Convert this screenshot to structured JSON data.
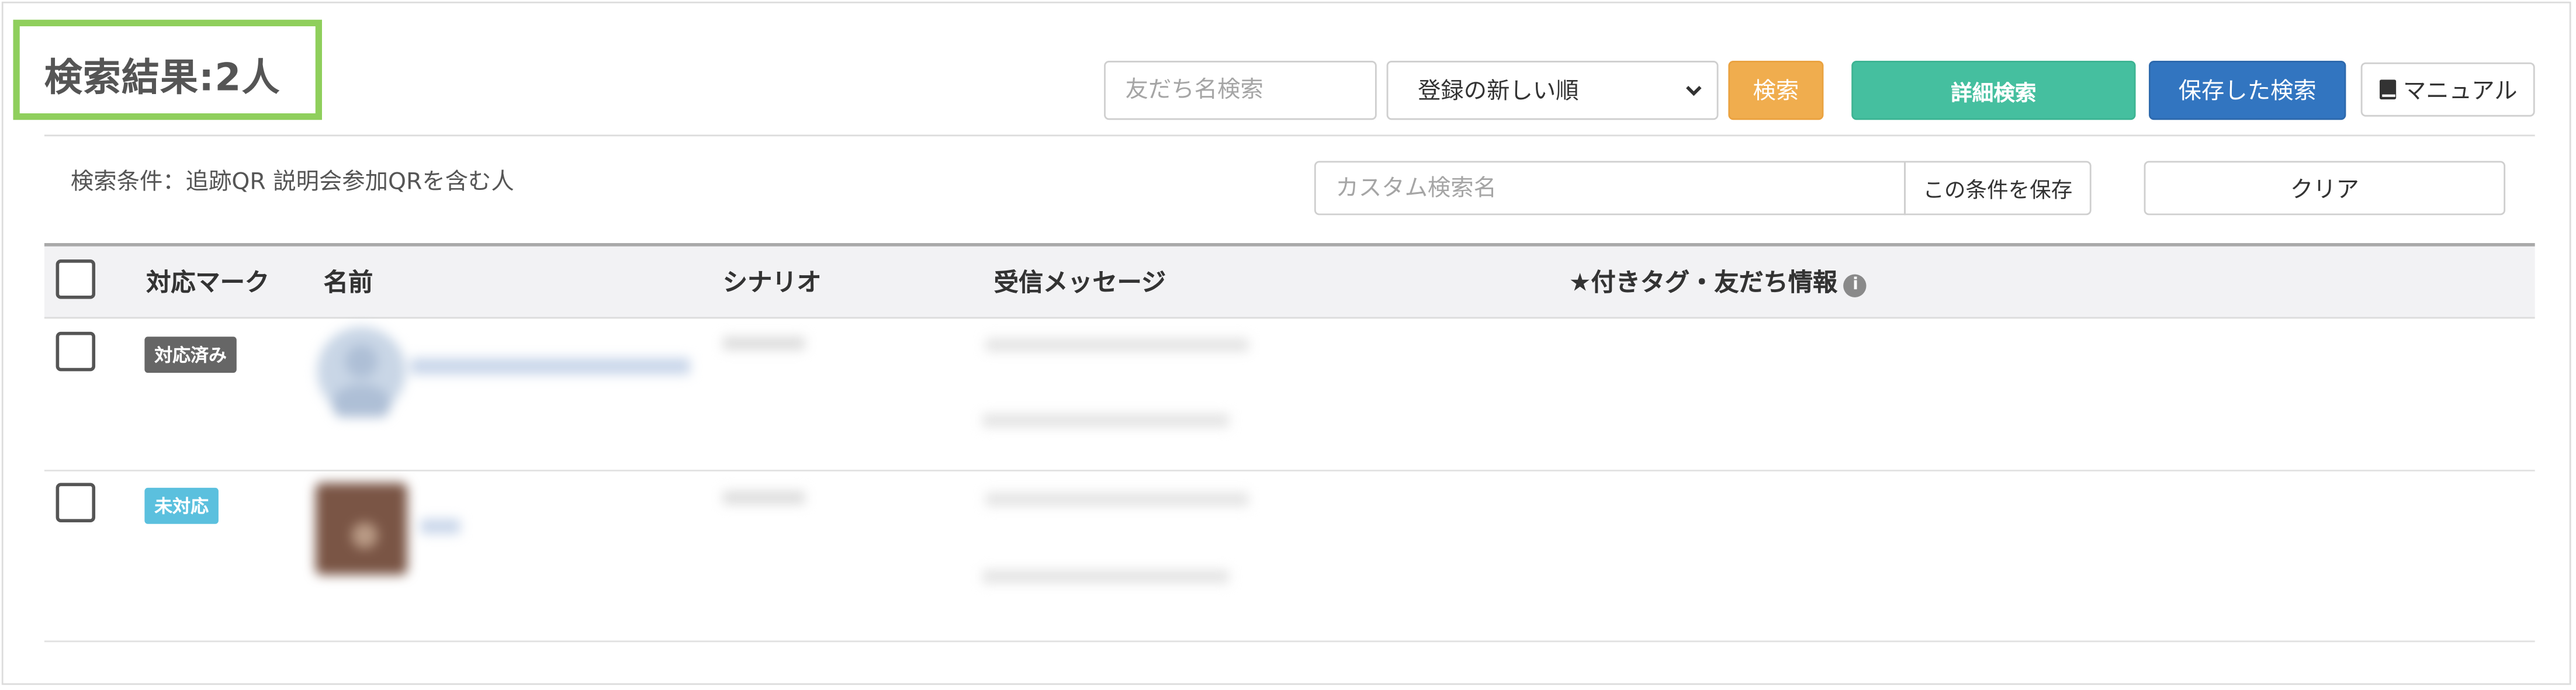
{
  "header": {
    "title": "検索結果:2人"
  },
  "toolbar": {
    "friend_search_placeholder": "友だち名検索",
    "sort_selected": "登録の新しい順",
    "search_label": "検索",
    "advanced_search_label": "詳細検索",
    "saved_search_label": "保存した検索",
    "manual_label": "マニュアル"
  },
  "conditions": {
    "text": "検索条件：追跡QR 説明会参加QRを含む人",
    "custom_name_placeholder": "カスタム検索名",
    "save_condition_label": "この条件を保存",
    "clear_label": "クリア"
  },
  "table": {
    "headers": [
      "対応マーク",
      "名前",
      "シナリオ",
      "受信メッセージ",
      "★付きタグ・友だち情報"
    ],
    "rows": [
      {
        "status": "対応済み",
        "status_color": "#666666"
      },
      {
        "status": "未対応",
        "status_color": "#5bc0de"
      }
    ]
  },
  "icons": {
    "manual": "book-icon",
    "info": "info-icon",
    "select": "chevron-down-icon"
  }
}
